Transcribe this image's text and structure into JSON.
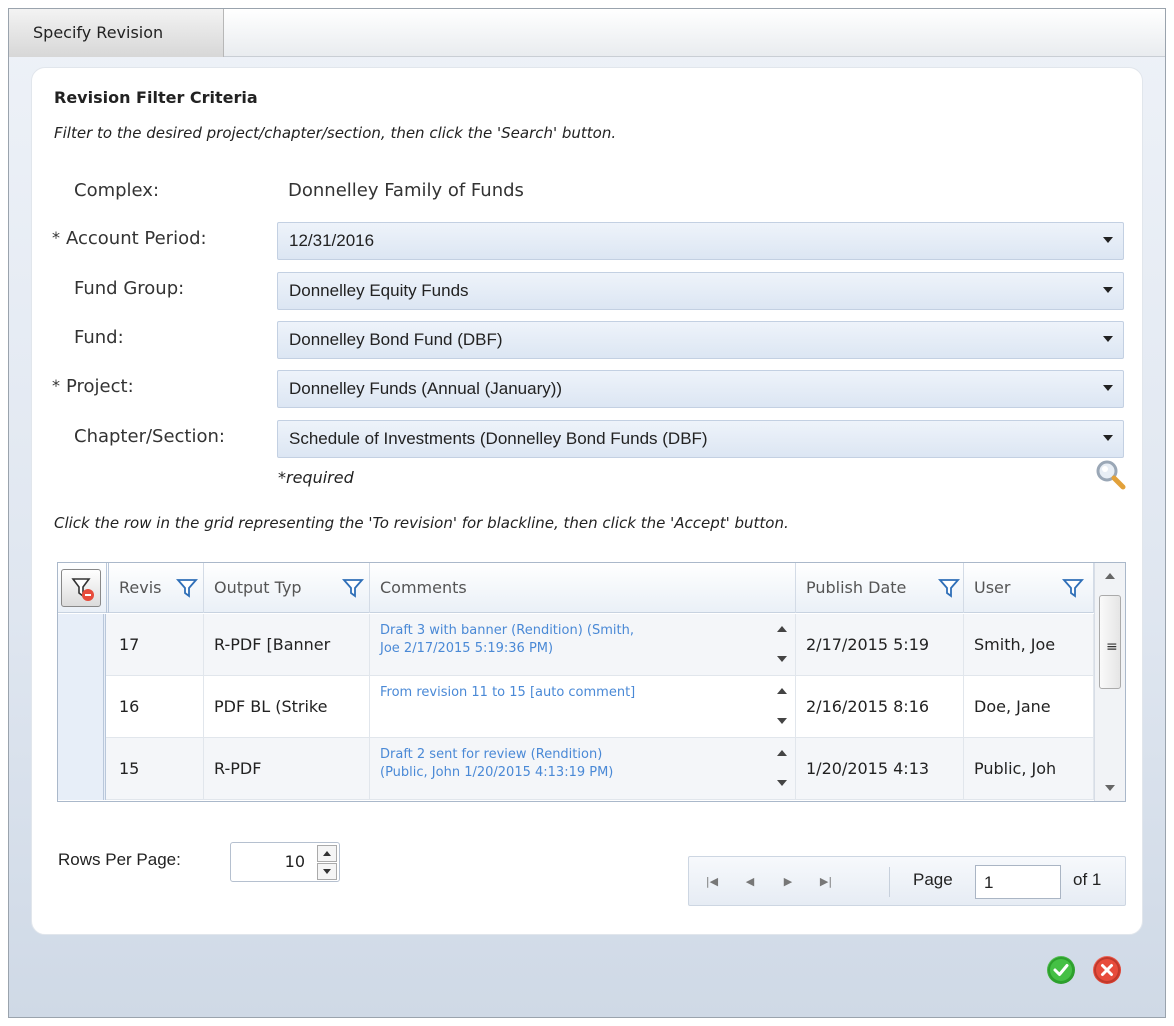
{
  "window": {
    "title": "Specify Revision"
  },
  "panel": {
    "heading": "Revision Filter Criteria",
    "instruction_top": "Filter to the desired project/chapter/section, then click the 'Search' button.",
    "instruction_bottom": "Click the row in the grid representing the 'To revision' for blackline, then click the 'Accept' button.",
    "required_note": "*required"
  },
  "form": {
    "complex": {
      "label": "Complex:",
      "value": "Donnelley Family of Funds"
    },
    "account_period": {
      "label": "Account Period:",
      "required_mark": "*",
      "value": "12/31/2016"
    },
    "fund_group": {
      "label": "Fund Group:",
      "value": "Donnelley Equity Funds"
    },
    "fund": {
      "label": "Fund:",
      "value": "Donnelley Bond Fund (DBF)"
    },
    "project": {
      "label": "Project:",
      "required_mark": "*",
      "value": "Donnelley Funds (Annual (January))"
    },
    "chapter_section": {
      "label": "Chapter/Section:",
      "value": "Schedule of Investments (Donnelley Bond Funds (DBF)"
    }
  },
  "grid": {
    "columns": [
      "Revis",
      "Output Typ",
      "Comments",
      "Publish Date",
      "User"
    ],
    "rows": [
      {
        "revision": "17",
        "output_type": "R-PDF [Banner",
        "comment_line1": "Draft 3 with banner (Rendition) (Smith,",
        "comment_line2": "Joe 2/17/2015 5:19:36 PM)",
        "publish_date": "2/17/2015 5:19",
        "user": "Smith, Joe"
      },
      {
        "revision": "16",
        "output_type": "PDF BL (Strike",
        "comment_line1": "From revision 11 to 15 [auto comment]",
        "comment_line2": "",
        "publish_date": "2/16/2015 8:16",
        "user": "Doe, Jane"
      },
      {
        "revision": "15",
        "output_type": "R-PDF",
        "comment_line1": "Draft 2 sent for review (Rendition)",
        "comment_line2": "(Public, John 1/20/2015 4:13:19 PM)",
        "publish_date": "1/20/2015 4:13",
        "user": "Public, Joh"
      }
    ]
  },
  "pager": {
    "rows_per_page_label": "Rows Per Page:",
    "rows_per_page_value": "10",
    "page_label": "Page",
    "page_value": "1",
    "of_label": "of 1"
  },
  "icons": {
    "search": "search-icon",
    "accept": "accept-icon",
    "cancel": "cancel-icon",
    "clear_filter": "clear-filter-icon",
    "column_filter": "filter-icon"
  },
  "colors": {
    "accent_link": "#4a89d6",
    "accept": "#2ca02c",
    "cancel": "#e04030"
  }
}
